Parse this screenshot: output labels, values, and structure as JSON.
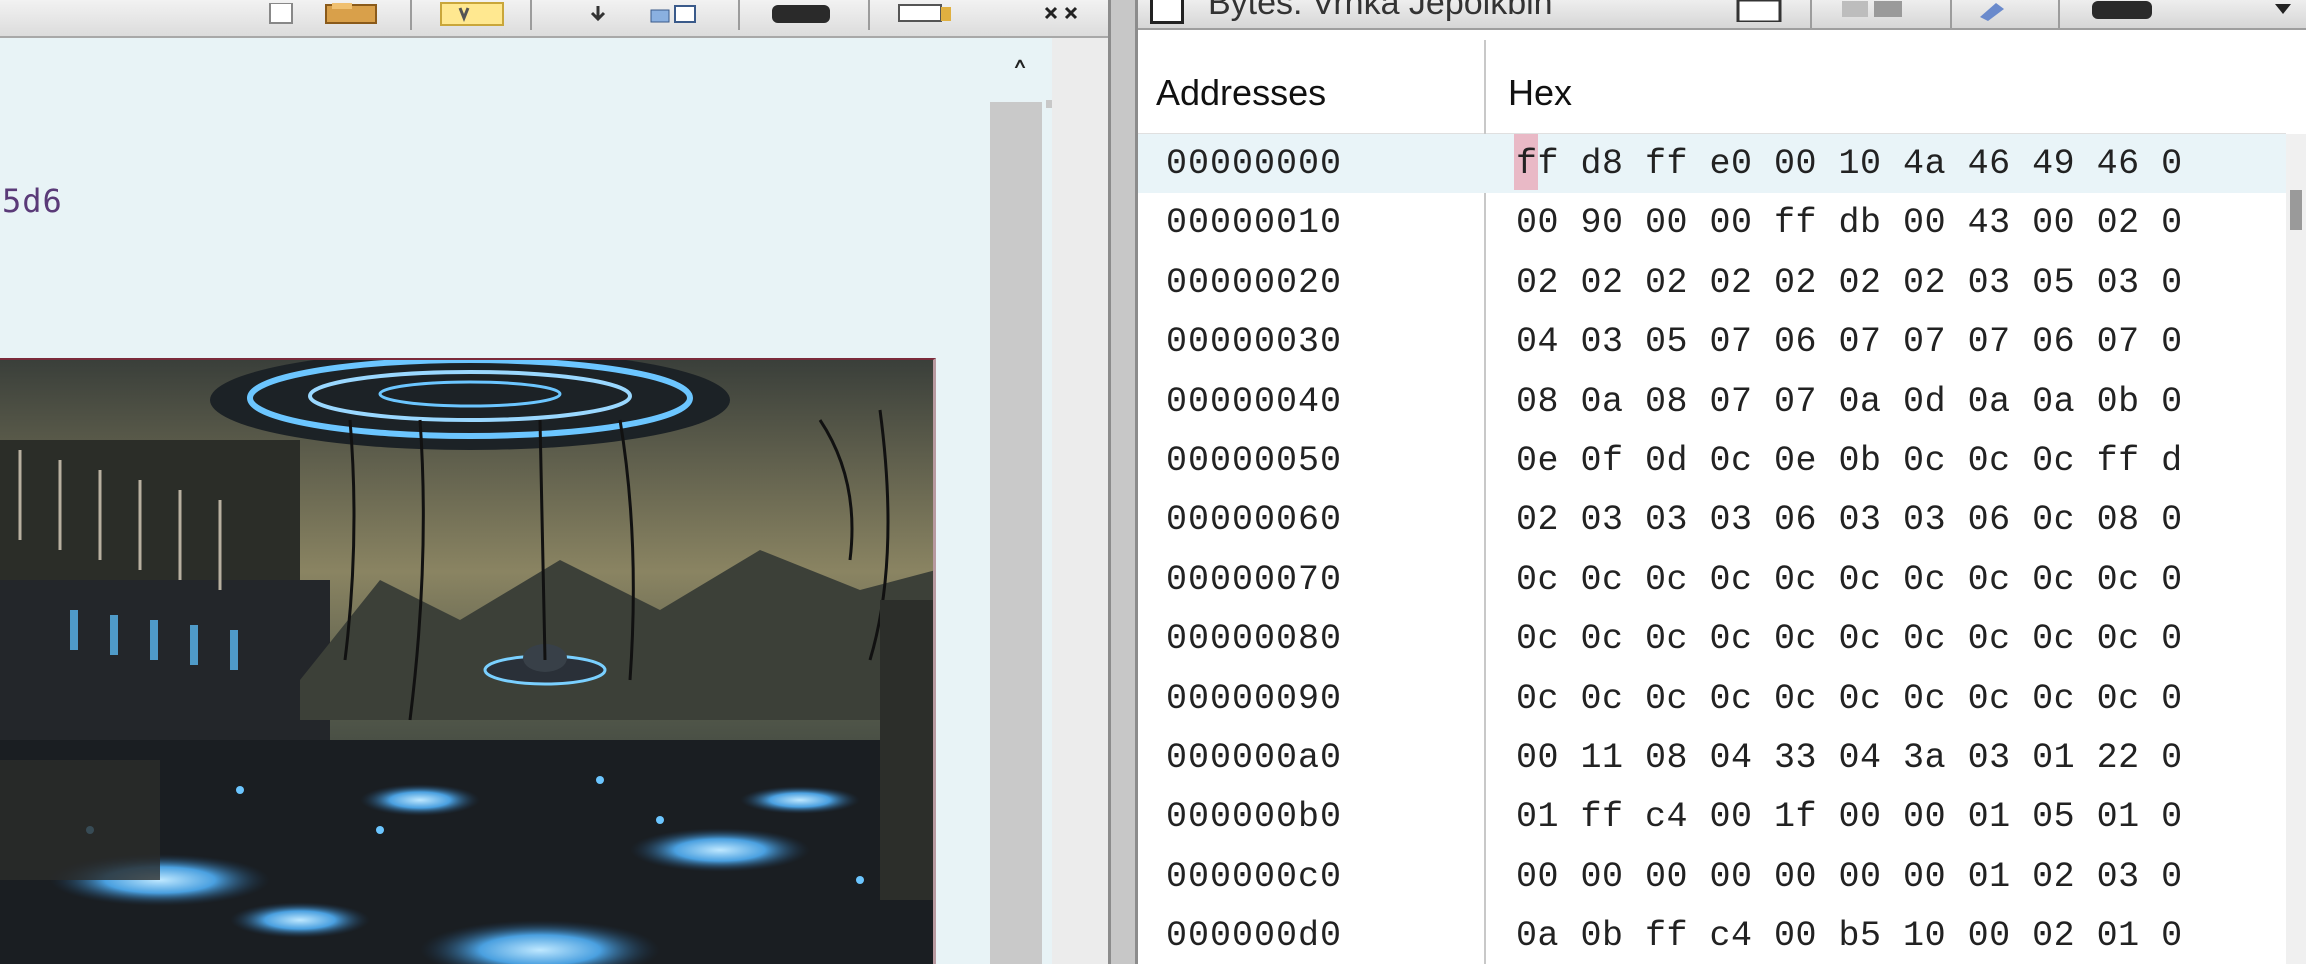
{
  "left_pane": {
    "hash_fragment": "5d6",
    "toolbar_icons": [
      "page-icon",
      "folder-icon",
      "highlight-icon",
      "download-icon",
      "view-icon",
      "record-icon",
      "panel-icon",
      "close-icon"
    ]
  },
  "right_pane": {
    "window_title": "Bytes: Vrnka Jepolkbin",
    "toolbar_icons": [
      "export-icon",
      "copy-icon",
      "paste-icon",
      "edit-icon",
      "settings-icon",
      "chevron-down-icon"
    ],
    "columns": {
      "addresses": "Addresses",
      "hex": "Hex"
    },
    "rows": [
      {
        "addr": "00000000",
        "hex": "ff d8 ff e0 00 10 4a 46 49 46 0"
      },
      {
        "addr": "00000010",
        "hex": "00 90 00 00 ff db 00 43 00 02 0"
      },
      {
        "addr": "00000020",
        "hex": "02 02 02 02 02 02 02 03 05 03 0"
      },
      {
        "addr": "00000030",
        "hex": "04 03 05 07 06 07 07 07 06 07 0"
      },
      {
        "addr": "00000040",
        "hex": "08 0a 08 07 07 0a 0d 0a 0a 0b 0"
      },
      {
        "addr": "00000050",
        "hex": "0e 0f 0d 0c 0e 0b 0c 0c 0c ff d"
      },
      {
        "addr": "00000060",
        "hex": "02 03 03 03 06 03 03 06 0c 08 0"
      },
      {
        "addr": "00000070",
        "hex": "0c 0c 0c 0c 0c 0c 0c 0c 0c 0c 0"
      },
      {
        "addr": "00000080",
        "hex": "0c 0c 0c 0c 0c 0c 0c 0c 0c 0c 0"
      },
      {
        "addr": "00000090",
        "hex": "0c 0c 0c 0c 0c 0c 0c 0c 0c 0c 0"
      },
      {
        "addr": "000000a0",
        "hex": "00 11 08 04 33 04 3a 03 01 22 0"
      },
      {
        "addr": "000000b0",
        "hex": "01 ff c4 00 1f 00 00 01 05 01 0"
      },
      {
        "addr": "000000c0",
        "hex": "00 00 00 00 00 00 00 01 02 03 0"
      },
      {
        "addr": "000000d0",
        "hex": "0a 0b ff c4 00 b5 10 00 02 01 0"
      }
    ]
  },
  "colors": {
    "left_background": "#e8f3f6",
    "hash_text": "#5a3a78",
    "cursor_highlight": "#e8a0b0",
    "first_row_highlight": "#e9f4f8"
  }
}
